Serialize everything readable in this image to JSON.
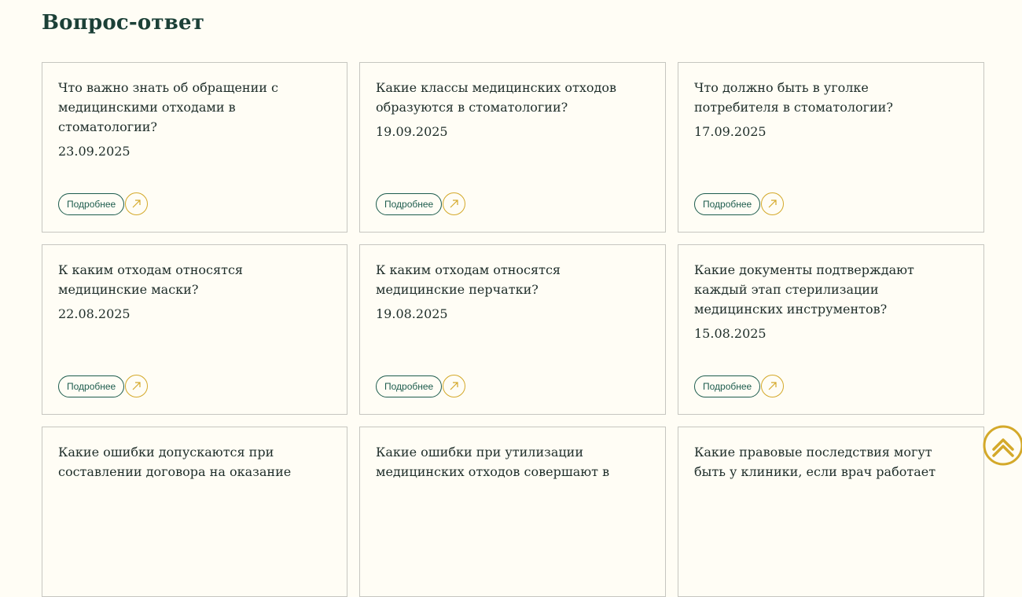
{
  "page": {
    "title": "Вопрос-ответ"
  },
  "colors": {
    "background": "#fffdf5",
    "title": "#1c4037",
    "text": "#1e2d29",
    "card_border": "#c6c6c0",
    "button_green": "#1d5c4d",
    "accent_gold": "#d4a92a"
  },
  "icons": {
    "card_arrow": "arrow-up-right-icon",
    "scroll_top": "chevron-up-icon"
  },
  "faq": {
    "more_label": "Подробнее",
    "items": [
      {
        "question": "Что важно знать об обращении с медицинскими отходами в стоматологии?",
        "date": "23.09.2025"
      },
      {
        "question": "Какие классы медицинских отходов образуются в стоматологии?",
        "date": "19.09.2025"
      },
      {
        "question": "Что должно быть в уголке потребителя в стоматологии?",
        "date": "17.09.2025"
      },
      {
        "question": "К каким отходам относятся медицинские маски?",
        "date": "22.08.2025"
      },
      {
        "question": "К каким отходам относятся медицинские перчатки?",
        "date": "19.08.2025"
      },
      {
        "question": "Какие документы подтверждают каждый этап стерилизации медицинских инструментов?",
        "date": "15.08.2025"
      },
      {
        "question": "Какие ошибки допускаются при составлении договора на оказание",
        "date": ""
      },
      {
        "question": "Какие ошибки при утилизации медицинских отходов совершают в",
        "date": ""
      },
      {
        "question": "Какие правовые последствия могут быть у клиники, если врач работает",
        "date": ""
      }
    ]
  }
}
